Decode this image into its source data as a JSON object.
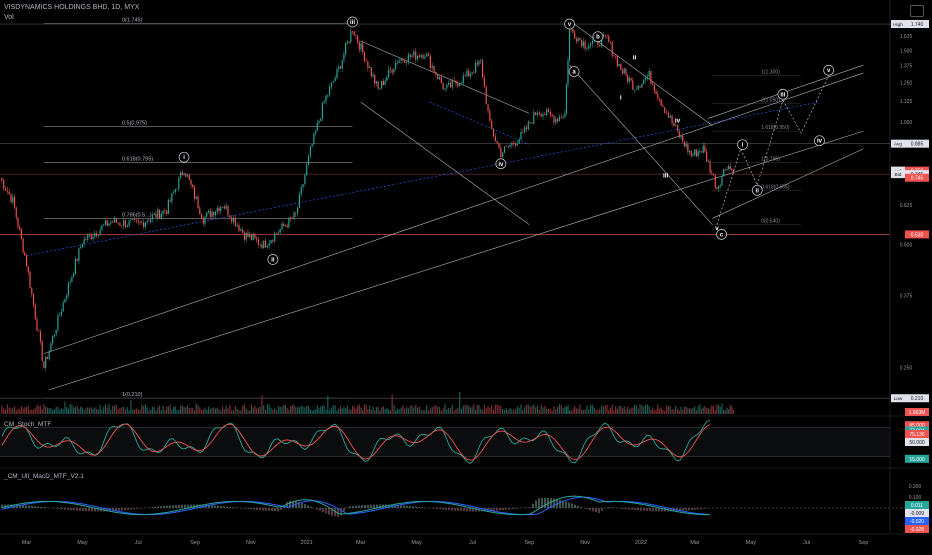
{
  "header": {
    "title": "VISDYNAMICS HOLDINGS BHD, 1D, MYX",
    "vol_label": "Vol"
  },
  "colors": {
    "background": "#000000",
    "up": "#26a69a",
    "down": "#ef5350",
    "trendline": "#b0b3b8",
    "midline": "#2962ff",
    "support": "#ef5350",
    "text": "#d1d4dc"
  },
  "chart_data": [
    {
      "type": "line",
      "subtype": "candlestick",
      "title": "VISDYNAMICS HOLDINGS BHD, 1D, MYX",
      "y_scale": "log",
      "ylim": [
        0.22,
        1.78
      ],
      "y_ticks": [
        "1.625",
        "1.500",
        "1.375",
        "1.250",
        "1.125",
        "1.000",
        "0.875",
        "0.750",
        "0.625",
        "0.500",
        "0.375",
        "0.250"
      ],
      "x_ticks": [
        "Mar",
        "May",
        "Jul",
        "Sep",
        "Nov",
        "2021",
        "Mar",
        "May",
        "Jul",
        "Sep",
        "Nov",
        "2022",
        "Mar",
        "May",
        "Jul",
        "Sep"
      ],
      "price_path": [
        [
          "2020-02-01",
          0.73
        ],
        [
          "2020-02-15",
          0.64
        ],
        [
          "2020-03-01",
          0.45
        ],
        [
          "2020-03-20",
          0.25
        ],
        [
          "2020-04-10",
          0.36
        ],
        [
          "2020-05-01",
          0.51
        ],
        [
          "2020-06-01",
          0.57
        ],
        [
          "2020-07-01",
          0.56
        ],
        [
          "2020-08-01",
          0.61
        ],
        [
          "2020-08-20",
          0.77
        ],
        [
          "2020-09-10",
          0.58
        ],
        [
          "2020-10-01",
          0.63
        ],
        [
          "2020-10-25",
          0.53
        ],
        [
          "2020-11-15",
          0.5
        ],
        [
          "2020-12-05",
          0.55
        ],
        [
          "2020-12-20",
          0.59
        ],
        [
          "2021-01-05",
          0.85
        ],
        [
          "2021-01-20",
          1.12
        ],
        [
          "2021-02-05",
          1.35
        ],
        [
          "2021-02-20",
          1.7
        ],
        [
          "2021-03-05",
          1.45
        ],
        [
          "2021-03-20",
          1.2
        ],
        [
          "2021-04-10",
          1.42
        ],
        [
          "2021-05-10",
          1.48
        ],
        [
          "2021-06-01",
          1.2
        ],
        [
          "2021-06-25",
          1.3
        ],
        [
          "2021-07-10",
          1.4
        ],
        [
          "2021-07-20",
          0.98
        ],
        [
          "2021-08-01",
          0.84
        ],
        [
          "2021-08-25",
          0.93
        ],
        [
          "2021-09-10",
          1.07
        ],
        [
          "2021-09-30",
          1.02
        ],
        [
          "2021-10-10",
          1.05
        ],
        [
          "2021-10-15",
          1.69
        ],
        [
          "2021-11-01",
          1.55
        ],
        [
          "2021-11-25",
          1.6
        ],
        [
          "2021-12-10",
          1.35
        ],
        [
          "2021-12-25",
          1.22
        ],
        [
          "2022-01-10",
          1.3
        ],
        [
          "2022-01-25",
          1.1
        ],
        [
          "2022-02-10",
          0.94
        ],
        [
          "2022-02-25",
          0.83
        ],
        [
          "2022-03-10",
          0.86
        ],
        [
          "2022-03-25",
          0.69
        ],
        [
          "2022-04-05",
          0.79
        ],
        [
          "2022-04-12",
          0.75
        ]
      ],
      "fib_levels": [
        {
          "label": "0(1.745)",
          "value": 1.745
        },
        {
          "label": "0.5(0.975)",
          "value": 0.975
        },
        {
          "label": "0.618(0.795)",
          "value": 0.795
        },
        {
          "label": "0.786(0.5...)",
          "value": 0.58
        },
        {
          "label": "1(0.210)",
          "value": 0.21
        }
      ],
      "projection_levels": [
        {
          "label": "1(1.300)",
          "value": 1.3
        },
        {
          "label": "2(1.050)",
          "value": 1.11
        },
        {
          "label": "1.618(0.950)",
          "value": 0.95
        },
        {
          "label": "1(0.795)",
          "value": 0.795
        },
        {
          "label": "0.618(0.655)",
          "value": 0.68
        },
        {
          "label": "0(0.540)",
          "value": 0.56
        }
      ],
      "price_labels": [
        {
          "label": "High",
          "value": "1.740",
          "style": "white"
        },
        {
          "label": "Avg",
          "value": "0.885",
          "style": "white"
        },
        {
          "label": "Ask",
          "value": "0.750",
          "style": "red"
        },
        {
          "label": "Bid",
          "value": "0.745",
          "style": "white"
        },
        {
          "label": "",
          "value": "0.745",
          "style": "red"
        },
        {
          "label": "",
          "value": "0.530",
          "style": "red"
        },
        {
          "label": "Low",
          "value": "0.210",
          "style": "white"
        }
      ],
      "wave_labels": [
        {
          "text": "iii",
          "circled": true
        },
        {
          "text": "v",
          "circled": true
        },
        {
          "text": "b",
          "circled": true
        },
        {
          "text": "a",
          "circled": true
        },
        {
          "text": "ii",
          "circled": false
        },
        {
          "text": "i",
          "circled": true
        },
        {
          "text": "iv",
          "circled": true
        },
        {
          "text": "ii",
          "circled": true
        },
        {
          "text": "i",
          "circled": false
        },
        {
          "text": "iv",
          "circled": false
        },
        {
          "text": "iii",
          "circled": false
        },
        {
          "text": "v",
          "circled": false
        },
        {
          "text": "c",
          "circled": true
        },
        {
          "text": "i",
          "circled": true
        },
        {
          "text": "ii",
          "circled": true
        },
        {
          "text": "iii",
          "circled": true
        },
        {
          "text": "iv",
          "circled": true
        },
        {
          "text": "v",
          "circled": true
        }
      ]
    },
    {
      "type": "bar",
      "title": "Vol",
      "price_labels": [
        {
          "value": "1.663M",
          "style": "red"
        }
      ]
    },
    {
      "type": "line",
      "title": "CM_Stoch_MTF",
      "ylim": [
        0,
        100
      ],
      "levels": [
        80,
        20
      ],
      "price_labels": [
        {
          "value": "85.000",
          "style": "red"
        },
        {
          "value": "77.904",
          "style": "green"
        },
        {
          "value": "75.136",
          "style": "red"
        },
        {
          "value": "50.000",
          "style": "white"
        },
        {
          "value": "15.000",
          "style": "green"
        }
      ]
    },
    {
      "type": "line",
      "title": "_CM_Ult_MacD_MTF_V2.1",
      "y_ticks": [
        "0.200",
        "0.100",
        "-0.100"
      ],
      "price_labels": [
        {
          "value": "0.011",
          "style": "green"
        },
        {
          "value": "-0.009",
          "style": "white"
        },
        {
          "value": "-0.020",
          "style": "blue"
        },
        {
          "value": "-0.028",
          "style": "red"
        }
      ]
    }
  ]
}
